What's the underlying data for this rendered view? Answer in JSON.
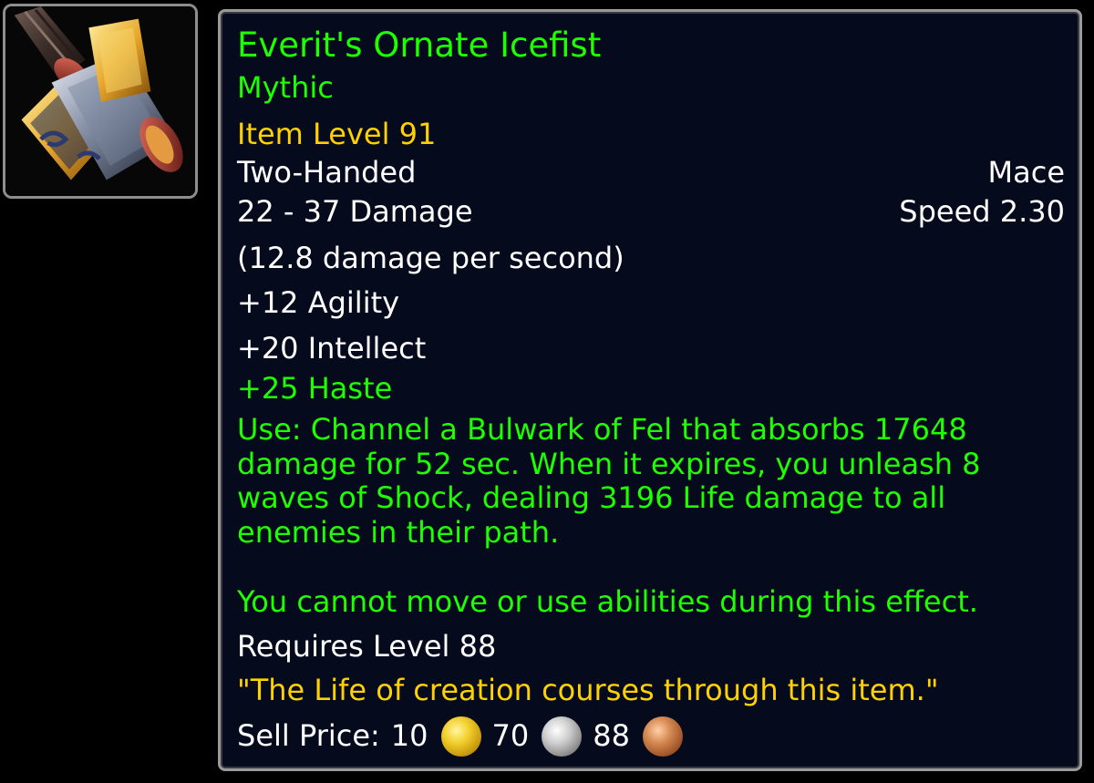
{
  "item": {
    "name": "Everit's Ornate Icefist",
    "quality": "Mythic",
    "item_level": "Item Level 91",
    "hands": "Two-Handed",
    "weapon_type": "Mace",
    "damage": "22 - 37 Damage",
    "speed": "Speed 2.30",
    "dps": "(12.8 damage per second)",
    "stats": [
      "+12 Agility",
      "+20 Intellect",
      "+25 Haste"
    ],
    "use_effect": "Use: Channel a Bulwark of Fel that absorbs 17648 damage for 52 sec. When it expires, you unleash 8 waves of Shock, dealing 3196 Life damage to all enemies in their path.",
    "use_note": "You cannot move or use abilities during this effect.",
    "requirement": "Requires Level 88",
    "flavor_text": "\"The Life of creation courses through this item.\"",
    "sell_price": {
      "label": "Sell Price:",
      "gold": "10",
      "silver": "70",
      "copper": "88"
    }
  },
  "icons": {
    "item_icon": "mace-icon",
    "gold": "gold-coin-icon",
    "silver": "silver-coin-icon",
    "copper": "copper-coin-icon"
  },
  "colors": {
    "name": "#1eff00",
    "quality": "#1eff00",
    "item_level": "#ffd100",
    "flavor": "#ffd100",
    "stat_bonus": "#1eff00",
    "use_effect": "#1eff00",
    "white": "#ffffff",
    "tooltip_background": "#050a1c",
    "border": "#9a9a9a"
  }
}
